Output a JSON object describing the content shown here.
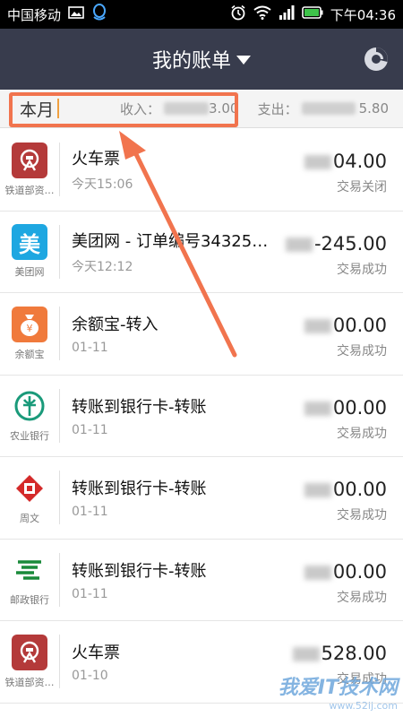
{
  "status_bar": {
    "carrier": "中国移动",
    "time": "下午04:36"
  },
  "header": {
    "title": "我的账单"
  },
  "summary": {
    "period": "本月",
    "income_label": "收入：",
    "income_value_visible": "3.00",
    "expense_label": "支出：",
    "expense_value_visible": "5.80"
  },
  "transactions": [
    {
      "name": "火车票",
      "date": "今天15:06",
      "amount_visible": "04.00",
      "status": "交易关闭",
      "logo_label": "铁道部资…",
      "logo_color": "#b43a3a",
      "icon": "railway-icon"
    },
    {
      "name": "美团网 - 订单编号34325…",
      "date": "今天12:12",
      "amount_visible": "-245.00",
      "status": "交易成功",
      "logo_label": "美团网",
      "logo_color": "#1ea7e1",
      "icon": "meituan-icon"
    },
    {
      "name": "余额宝-转入",
      "date": "01-11",
      "amount_visible": "00.00",
      "status": "交易成功",
      "logo_label": "余额宝",
      "logo_color": "#f07a3c",
      "icon": "money-bag-icon"
    },
    {
      "name": "转账到银行卡-转账",
      "date": "01-11",
      "amount_visible": "00.00",
      "status": "交易成功",
      "logo_label": "农业银行",
      "logo_color": "#1a9a7a",
      "icon": "abc-bank-icon"
    },
    {
      "name": "转账到银行卡-转账",
      "date": "01-11",
      "amount_visible": "00.00",
      "status": "交易成功",
      "logo_label": "周文",
      "logo_color": "#d42a2a",
      "icon": "cmb-bank-icon"
    },
    {
      "name": "转账到银行卡-转账",
      "date": "01-11",
      "amount_visible": "00.00",
      "status": "交易成功",
      "logo_label": "邮政银行",
      "logo_color": "#1a8a3a",
      "icon": "postal-bank-icon"
    },
    {
      "name": "火车票",
      "date": "01-10",
      "amount_visible": "528.00",
      "status": "交易成功",
      "logo_label": "铁道部资…",
      "logo_color": "#b43a3a",
      "icon": "railway-icon"
    }
  ],
  "watermark": {
    "text": "我爱IT技术网",
    "url": "www.52ij.com"
  },
  "colors": {
    "header_bg": "#383c4d",
    "highlight": "#f1744e"
  }
}
